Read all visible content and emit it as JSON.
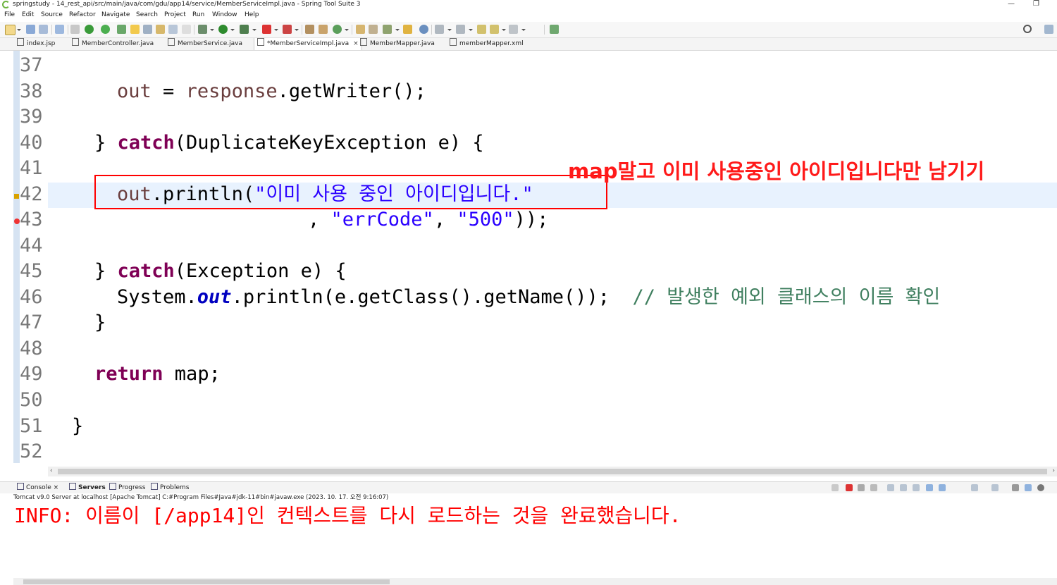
{
  "window": {
    "title": "springstudy - 14_rest_api/src/main/java/com/gdu/app14/service/MemberServiceImpl.java - Spring Tool Suite 3",
    "minimize": "—",
    "restore": "❐"
  },
  "menu": [
    "File",
    "Edit",
    "Source",
    "Refactor",
    "Navigate",
    "Search",
    "Project",
    "Run",
    "Window",
    "Help"
  ],
  "tabs": [
    {
      "label": "index.jsp",
      "icon": "jsp-file-icon",
      "active": false
    },
    {
      "label": "MemberController.java",
      "icon": "java-file-icon",
      "active": false
    },
    {
      "label": "MemberService.java",
      "icon": "java-file-icon",
      "active": false
    },
    {
      "label": "*MemberServiceImpl.java",
      "icon": "java-file-icon",
      "active": true,
      "close": "×"
    },
    {
      "label": "MemberMapper.java",
      "icon": "java-file-icon",
      "active": false
    },
    {
      "label": "memberMapper.xml",
      "icon": "xml-file-icon",
      "active": false
    }
  ],
  "editor": {
    "line_numbers": [
      "37",
      "38",
      "39",
      "40",
      "41",
      "42",
      "43",
      "44",
      "45",
      "46",
      "47",
      "48",
      "49",
      "50",
      "51",
      "52"
    ],
    "current_line": "42",
    "code": {
      "l38": {
        "var": "out",
        "eq": " = ",
        "var2": "response",
        "rest": ".getWriter();"
      },
      "l40": {
        "brace": "} ",
        "kw": "catch",
        "rest": "(DuplicateKeyException e) {"
      },
      "l42": {
        "var": "out",
        "rest": ".println(",
        "str": "\"이미 사용 중인 아이디입니다.\""
      },
      "l43": {
        "pre": ", ",
        "str1": "\"errCode\"",
        "mid": ", ",
        "str2": "\"500\"",
        "rest": "));"
      },
      "l45": {
        "brace": "} ",
        "kw": "catch",
        "rest": "(Exception e) {"
      },
      "l46": {
        "pre": "System.",
        "fld": "out",
        "rest": ".println(e.getClass().getName());  ",
        "cmt": "// 발생한 예외 클래스의 이름 확인"
      },
      "l47": {
        "brace": "}"
      },
      "l49": {
        "kw": "return",
        "rest": " map;"
      },
      "l51": {
        "brace": "}"
      }
    },
    "annotation": "map말고 이미 사용중인 아이디입니다만 남기기"
  },
  "panel": {
    "tabs": [
      {
        "label": "Console",
        "close": "×",
        "active": false
      },
      {
        "label": "Servers",
        "active": true
      },
      {
        "label": "Progress",
        "active": false
      },
      {
        "label": "Problems",
        "active": false
      }
    ],
    "console_header": "Tomcat v9.0 Server at localhost [Apache Tomcat] C:#Program Files#Java#jdk-11#bin#javaw.exe  (2023. 10. 17. 오전 9:16:07)",
    "console_output": "INFO: 이름이 [/app14]인 컨텍스트를 다시 로드하는 것을 완료했습니다."
  },
  "colors": {
    "keyword": "#7f0055",
    "string": "#2a00ff",
    "comment": "#3f7f5f",
    "annotation": "#ff1a1a",
    "console_error": "#ff0000",
    "current_line": "#e8f2fe"
  }
}
